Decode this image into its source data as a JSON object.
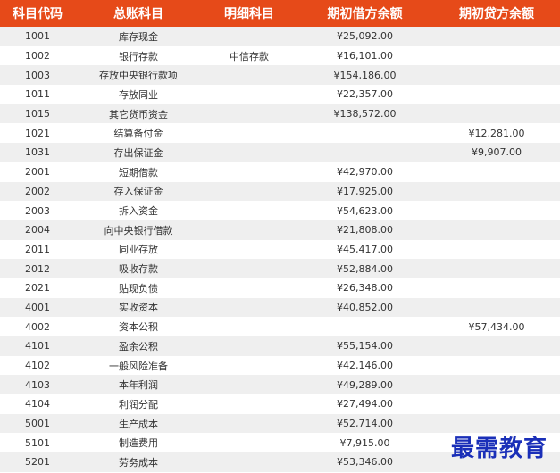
{
  "headers": [
    "科目代码",
    "总账科目",
    "明细科目",
    "期初借方余额",
    "期初贷方余额"
  ],
  "rows": [
    {
      "code": "1001",
      "account": "库存现金",
      "detail": "",
      "debit": "¥25,092.00",
      "credit": ""
    },
    {
      "code": "1002",
      "account": "银行存款",
      "detail": "中信存款",
      "debit": "¥16,101.00",
      "credit": ""
    },
    {
      "code": "1003",
      "account": "存放中央银行款项",
      "detail": "",
      "debit": "¥154,186.00",
      "credit": ""
    },
    {
      "code": "1011",
      "account": "存放同业",
      "detail": "",
      "debit": "¥22,357.00",
      "credit": ""
    },
    {
      "code": "1015",
      "account": "其它货币资金",
      "detail": "",
      "debit": "¥138,572.00",
      "credit": ""
    },
    {
      "code": "1021",
      "account": "结算备付金",
      "detail": "",
      "debit": "",
      "credit": "¥12,281.00"
    },
    {
      "code": "1031",
      "account": "存出保证金",
      "detail": "",
      "debit": "",
      "credit": "¥9,907.00"
    },
    {
      "code": "2001",
      "account": "短期借款",
      "detail": "",
      "debit": "¥42,970.00",
      "credit": ""
    },
    {
      "code": "2002",
      "account": "存入保证金",
      "detail": "",
      "debit": "¥17,925.00",
      "credit": ""
    },
    {
      "code": "2003",
      "account": "拆入资金",
      "detail": "",
      "debit": "¥54,623.00",
      "credit": ""
    },
    {
      "code": "2004",
      "account": "向中央银行借款",
      "detail": "",
      "debit": "¥21,808.00",
      "credit": ""
    },
    {
      "code": "2011",
      "account": "同业存放",
      "detail": "",
      "debit": "¥45,417.00",
      "credit": ""
    },
    {
      "code": "2012",
      "account": "吸收存款",
      "detail": "",
      "debit": "¥52,884.00",
      "credit": ""
    },
    {
      "code": "2021",
      "account": "贴现负债",
      "detail": "",
      "debit": "¥26,348.00",
      "credit": ""
    },
    {
      "code": "4001",
      "account": "实收资本",
      "detail": "",
      "debit": "¥40,852.00",
      "credit": ""
    },
    {
      "code": "4002",
      "account": "资本公积",
      "detail": "",
      "debit": "",
      "credit": "¥57,434.00"
    },
    {
      "code": "4101",
      "account": "盈余公积",
      "detail": "",
      "debit": "¥55,154.00",
      "credit": ""
    },
    {
      "code": "4102",
      "account": "一般风险准备",
      "detail": "",
      "debit": "¥42,146.00",
      "credit": ""
    },
    {
      "code": "4103",
      "account": "本年利润",
      "detail": "",
      "debit": "¥49,289.00",
      "credit": ""
    },
    {
      "code": "4104",
      "account": "利润分配",
      "detail": "",
      "debit": "¥27,494.00",
      "credit": ""
    },
    {
      "code": "5001",
      "account": "生产成本",
      "detail": "",
      "debit": "¥52,714.00",
      "credit": ""
    },
    {
      "code": "5101",
      "account": "制造费用",
      "detail": "",
      "debit": "¥7,915.00",
      "credit": ""
    },
    {
      "code": "5201",
      "account": "劳务成本",
      "detail": "",
      "debit": "¥53,346.00",
      "credit": ""
    }
  ],
  "watermark": "最需教育",
  "colors": {
    "header_bg": "#e64a19",
    "header_text": "#ffffff",
    "stripe": "#efefef",
    "watermark": "#1a2fb8"
  }
}
